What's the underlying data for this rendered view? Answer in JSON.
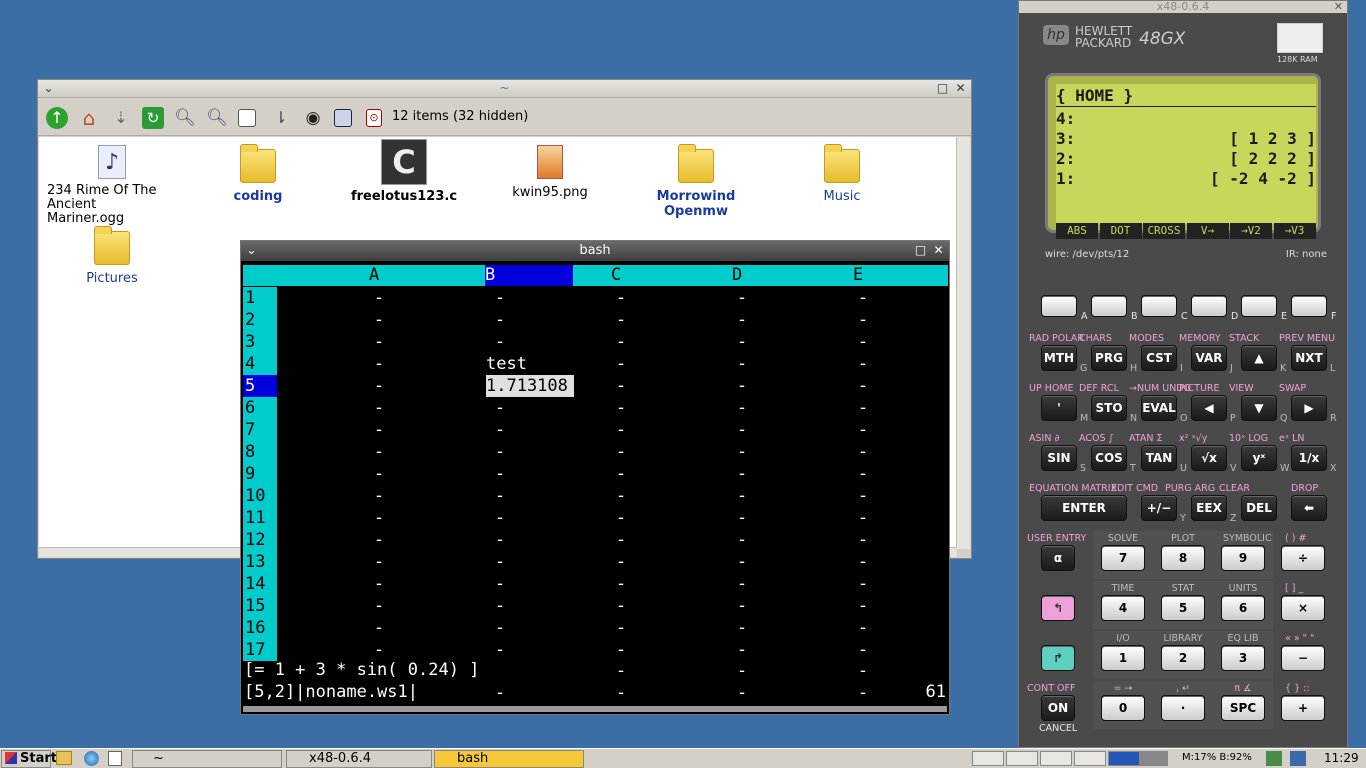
{
  "file_manager": {
    "title": "~",
    "status": "12 items (32 hidden)",
    "items": [
      {
        "label": "234 Rime Of The Ancient Mariner.ogg",
        "type": "audio"
      },
      {
        "label": "coding",
        "type": "folder"
      },
      {
        "label": "freelotus123.c",
        "type": "c-file"
      },
      {
        "label": "kwin95.png",
        "type": "image"
      },
      {
        "label": "Morrowind Openmw",
        "type": "folder"
      },
      {
        "label": "Music",
        "type": "folder"
      },
      {
        "label": "Pictures",
        "type": "folder"
      }
    ]
  },
  "terminal": {
    "title": "bash",
    "columns": [
      "A",
      "B",
      "C",
      "D",
      "E"
    ],
    "rows": [
      "1",
      "2",
      "3",
      "4",
      "5",
      "6",
      "7",
      "8",
      "9",
      "10",
      "11",
      "12",
      "13",
      "14",
      "15",
      "16",
      "17"
    ],
    "empty_cell": "-",
    "cells": {
      "B4": "test",
      "B5": "1.713108"
    },
    "formula": "[= 1 + 3 * sin( 0.24) ]",
    "status_left": "[5,2]|noname.ws1|",
    "status_right": "61",
    "selected": {
      "col": "B",
      "row": "5"
    }
  },
  "calculator": {
    "window_title": "x48-0.6.4",
    "brand_line1": "HEWLETT",
    "brand_line2": "PACKARD",
    "model": "48GX",
    "ram": "128K RAM",
    "logo": "hp",
    "display": {
      "header": "{ HOME }",
      "lines": [
        {
          "n": "4:",
          "v": ""
        },
        {
          "n": "3:",
          "v": "[ 1 2 3 ]"
        },
        {
          "n": "2:",
          "v": "[ 2 2 2 ]"
        },
        {
          "n": "1:",
          "v": "[ -2 4 -2 ]"
        }
      ],
      "menu": [
        "ABS",
        "DOT",
        "CROSS",
        "V→",
        "→V2",
        "→V3"
      ]
    },
    "wire": "wire: /dev/pts/12",
    "ir": "IR: none",
    "softkey_letters": [
      "A",
      "B",
      "C",
      "D",
      "E",
      "F"
    ],
    "rows": [
      {
        "labels": [
          "RAD POLAR",
          "CHARS",
          "MODES",
          "MEMORY",
          "STACK",
          "PREV MENU"
        ],
        "keys": [
          "MTH",
          "PRG",
          "CST",
          "VAR",
          "▲",
          "NXT"
        ],
        "letters": [
          "G",
          "H",
          "I",
          "J",
          "K",
          "L"
        ]
      },
      {
        "labels": [
          "UP HOME",
          "DEF RCL",
          "→NUM UNDO",
          "PICTURE",
          "VIEW",
          "SWAP"
        ],
        "keys": [
          "'",
          "STO",
          "EVAL",
          "◀",
          "▼",
          "▶"
        ],
        "letters": [
          "M",
          "N",
          "O",
          "P",
          "Q",
          "R"
        ]
      },
      {
        "labels": [
          "ASIN ∂",
          "ACOS ∫",
          "ATAN Σ",
          "x² ˣ√y",
          "10ˣ LOG",
          "eˣ LN"
        ],
        "keys": [
          "SIN",
          "COS",
          "TAN",
          "√x",
          "yˣ",
          "1/x"
        ],
        "letters": [
          "S",
          "T",
          "U",
          "V",
          "W",
          "X"
        ]
      },
      {
        "labels": [
          "EQUATION MATRIX",
          "EDIT CMD",
          "PURG ARG",
          "CLEAR",
          "DROP"
        ],
        "keys": [
          "ENTER",
          "+/−",
          "EEX",
          "DEL",
          "⬅"
        ],
        "letters": [
          "",
          "Y",
          "Z",
          "",
          ""
        ]
      }
    ],
    "num_rows": [
      {
        "left_label": "USER ENTRY",
        "left_key": "α",
        "labels": [
          "SOLVE",
          "PLOT",
          "SYMBOLIC"
        ],
        "keys": [
          "7",
          "8",
          "9"
        ],
        "op_label": "( )  #",
        "op": "÷"
      },
      {
        "left_label": "",
        "left_key": "↰",
        "labels": [
          "TIME",
          "STAT",
          "UNITS"
        ],
        "keys": [
          "4",
          "5",
          "6"
        ],
        "op_label": "[ ]  _",
        "op": "×"
      },
      {
        "left_label": "",
        "left_key": "↱",
        "labels": [
          "I/O",
          "LIBRARY",
          "EQ LIB"
        ],
        "keys": [
          "1",
          "2",
          "3"
        ],
        "op_label": "« »  \" \"",
        "op": "−"
      },
      {
        "left_label": "CONT OFF",
        "left_key": "ON",
        "labels": [
          "= →",
          ", ↵",
          "π ∡"
        ],
        "keys": [
          "0",
          "·",
          "SPC"
        ],
        "op_label": "{ }  ::",
        "op": "+",
        "under": "CANCEL"
      }
    ]
  },
  "taskbar": {
    "start": "Start",
    "tasks": [
      "~",
      "x48-0.6.4",
      "bash"
    ],
    "stats": "M:17% B:92%",
    "clock": "11:29"
  }
}
